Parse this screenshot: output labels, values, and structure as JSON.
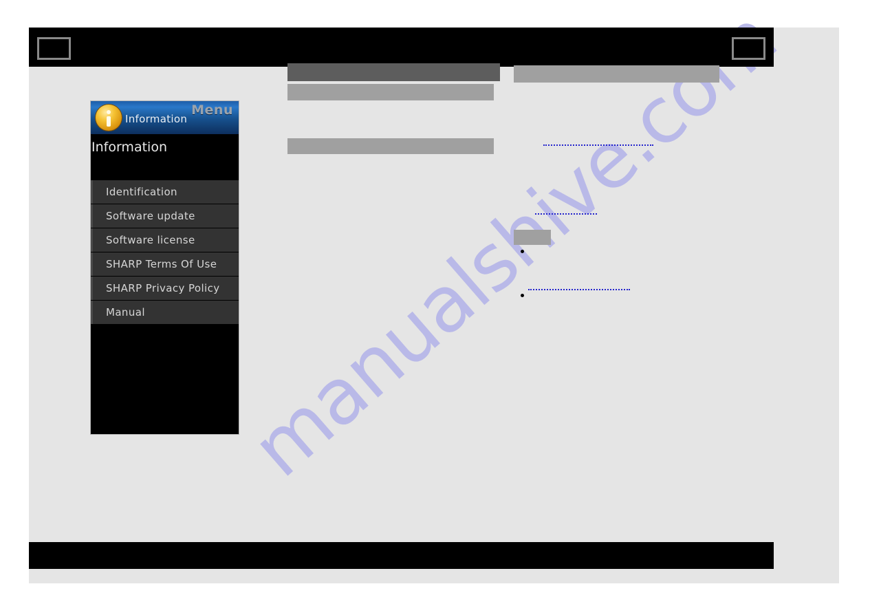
{
  "page": {
    "background_color": "#e5e5e5",
    "sheet_border_color": "#ffffff"
  },
  "header": {
    "background_color": "#000000",
    "nav_prev_label": "",
    "nav_next_label": ""
  },
  "footer": {
    "background_color": "#000000",
    "label": ""
  },
  "watermark": {
    "text": "manualshive.com",
    "color": "#b9b9e8"
  },
  "device_panel": {
    "titlebar": {
      "menu_word": "Menu",
      "icon_label": "Information",
      "icon_name": "information-icon",
      "accent_color": "#2a78c9"
    },
    "section_title": "Information",
    "menu_items": [
      {
        "label": "Identification"
      },
      {
        "label": "Software update"
      },
      {
        "label": "Software license"
      },
      {
        "label": "SHARP Terms Of Use"
      },
      {
        "label": "SHARP Privacy Policy"
      },
      {
        "label": "Manual"
      }
    ],
    "item_background_color": "#333333",
    "panel_background_color": "#000000"
  },
  "content": {
    "redacted_blocks": [
      {
        "name": "heading-dark",
        "color": "#5d5d5d",
        "text": ""
      },
      {
        "name": "subheading-one",
        "color": "#a0a0a0",
        "text": ""
      },
      {
        "name": "subheading-two",
        "color": "#a0a0a0",
        "text": ""
      },
      {
        "name": "right-heading",
        "color": "#a0a0a0",
        "text": ""
      },
      {
        "name": "inline-button",
        "color": "#a0a0a0",
        "text": ""
      }
    ],
    "dotted_links": [
      {
        "name": "dotted-link-one",
        "color": "#2222cc",
        "text": ""
      },
      {
        "name": "dotted-link-two",
        "color": "#2222cc",
        "text": ""
      },
      {
        "name": "dotted-link-three",
        "color": "#2222cc",
        "text": ""
      }
    ],
    "bullets": [
      {
        "text": ""
      },
      {
        "text": ""
      }
    ]
  }
}
